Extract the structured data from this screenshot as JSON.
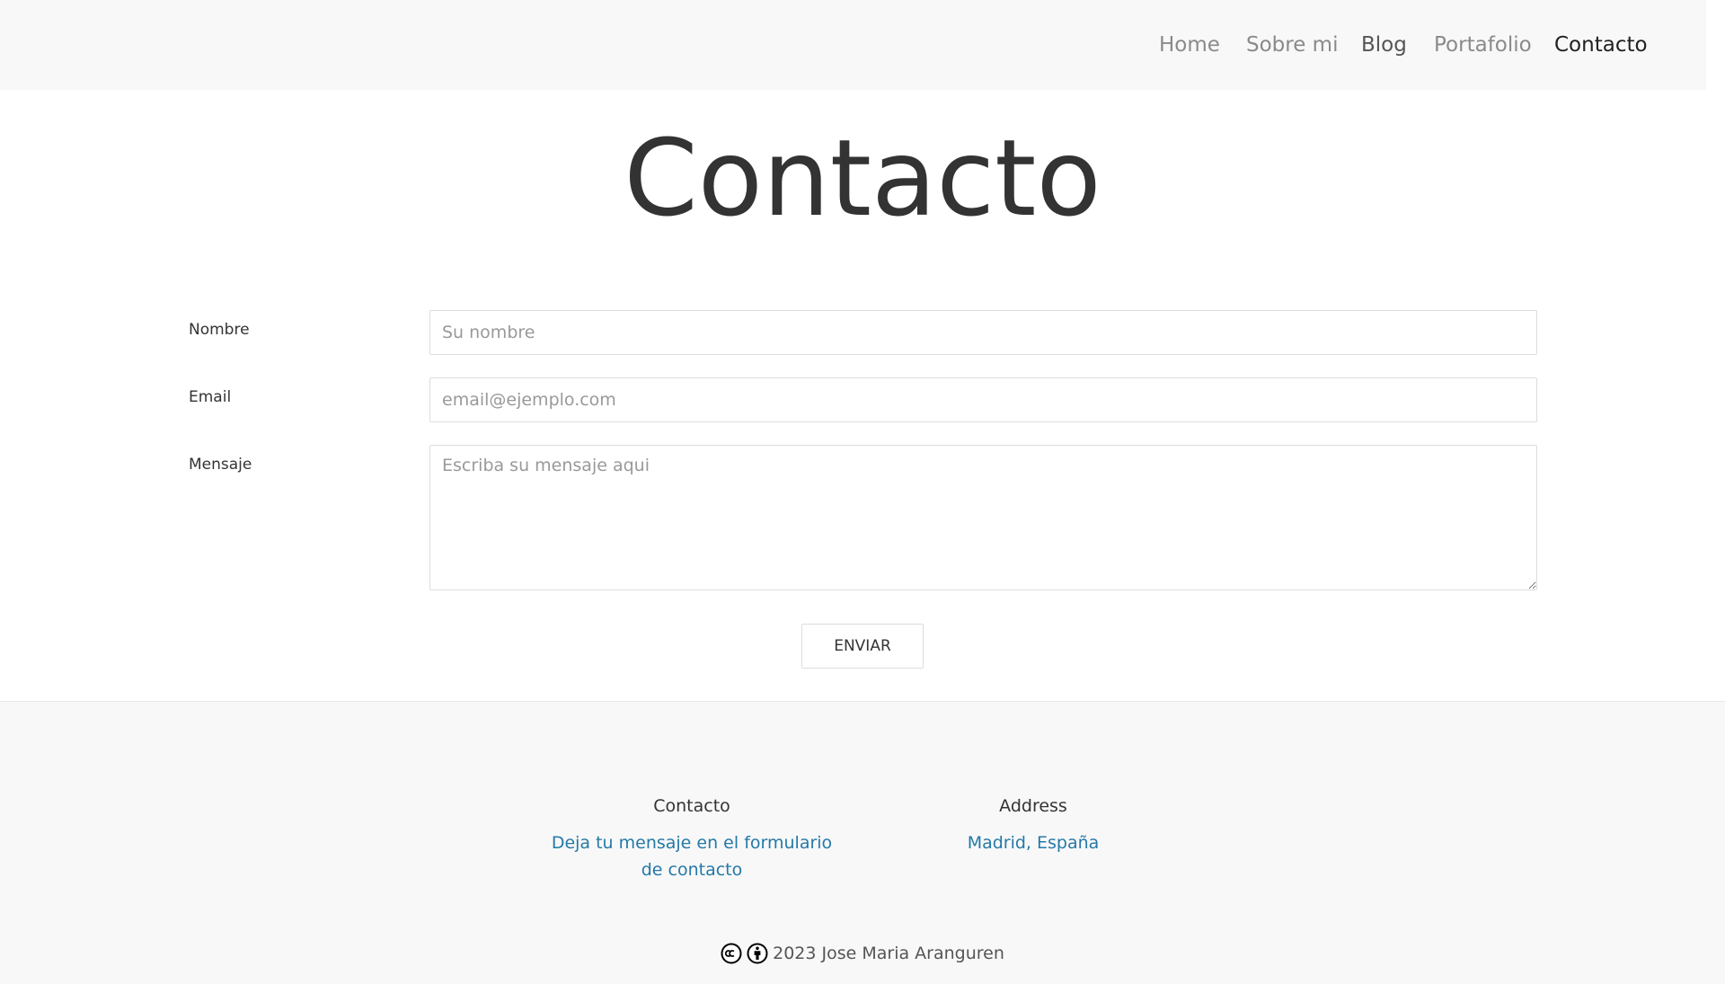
{
  "nav": {
    "items": [
      {
        "label": "Home"
      },
      {
        "label": "Sobre mi"
      },
      {
        "label": "Blog"
      },
      {
        "label": "Portafolio"
      },
      {
        "label": "Contacto"
      }
    ],
    "active": "Contacto"
  },
  "page": {
    "title": "Contacto"
  },
  "form": {
    "name_label": "Nombre",
    "name_placeholder": "Su nombre",
    "name_value": "",
    "email_label": "Email",
    "email_placeholder": "email@ejemplo.com",
    "email_value": "",
    "message_label": "Mensaje",
    "message_placeholder": "Escriba su mensaje aqui",
    "message_value": "",
    "submit_label": "ENVIAR"
  },
  "footer": {
    "contact_heading": "Contacto",
    "contact_link": "Deja tu mensaje en el formulario de contacto",
    "address_heading": "Address",
    "address_link": "Madrid, España",
    "copyright": "2023 Jose Maria Aranguren",
    "icons": [
      "creative-commons-icon",
      "attribution-icon"
    ]
  },
  "colors": {
    "background": "#ffffff",
    "navbar_bg": "#f8f8f8",
    "footer_bg": "#f8f8f8",
    "link": "#2479a8",
    "text": "#333333",
    "nav_text": "#8a8a8a"
  }
}
